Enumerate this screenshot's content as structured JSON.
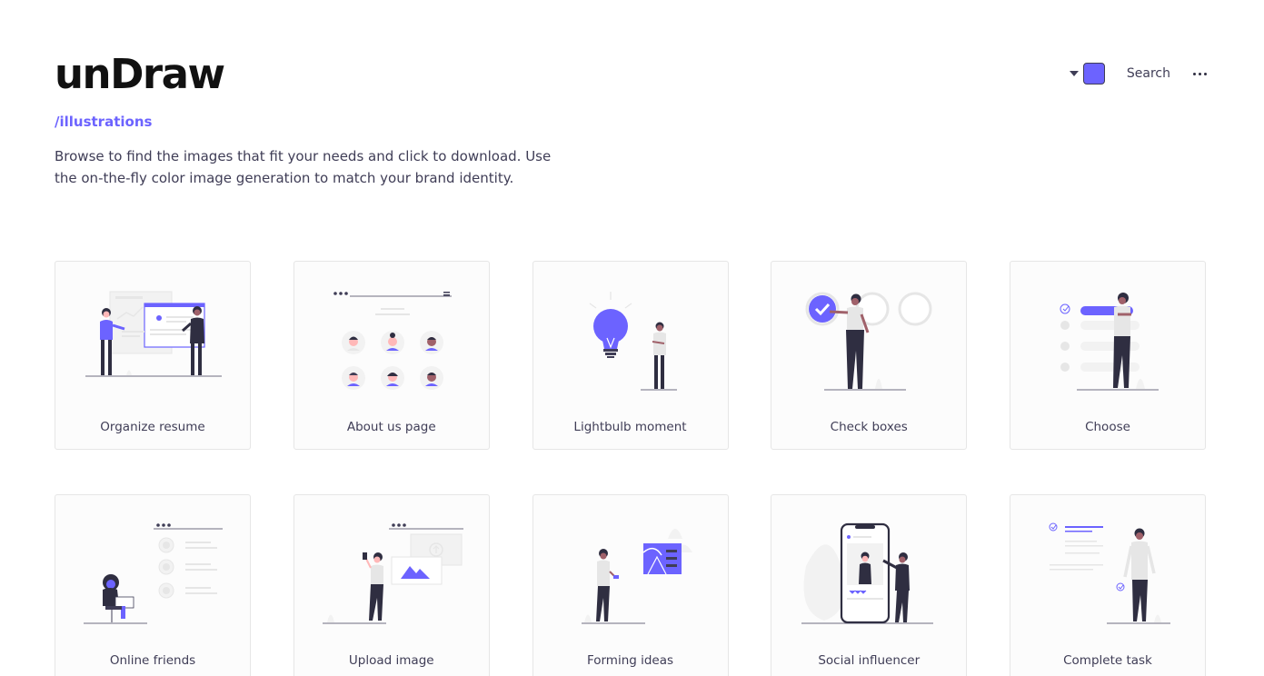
{
  "brand": {
    "logo": "unDraw",
    "subpath": "/illustrations"
  },
  "intro": "Browse to find the images that fit your needs and click to download. Use the on-the-fly color image generation to match your brand identity.",
  "header": {
    "accent_color": "#6c63ff",
    "search_label": "Search",
    "more_icon": "more-icon",
    "caret_icon": "caret-down-icon"
  },
  "colors": {
    "accent": "#6c63ff",
    "dark": "#2f2e41",
    "skin_dark": "#a0616a",
    "gray": "#e6e6e6"
  },
  "illustrations": [
    {
      "title": "Organize resume"
    },
    {
      "title": "About us page"
    },
    {
      "title": "Lightbulb moment"
    },
    {
      "title": "Check boxes"
    },
    {
      "title": "Choose"
    },
    {
      "title": "Online friends"
    },
    {
      "title": "Upload image"
    },
    {
      "title": "Forming ideas"
    },
    {
      "title": "Social influencer"
    },
    {
      "title": "Complete task"
    }
  ]
}
